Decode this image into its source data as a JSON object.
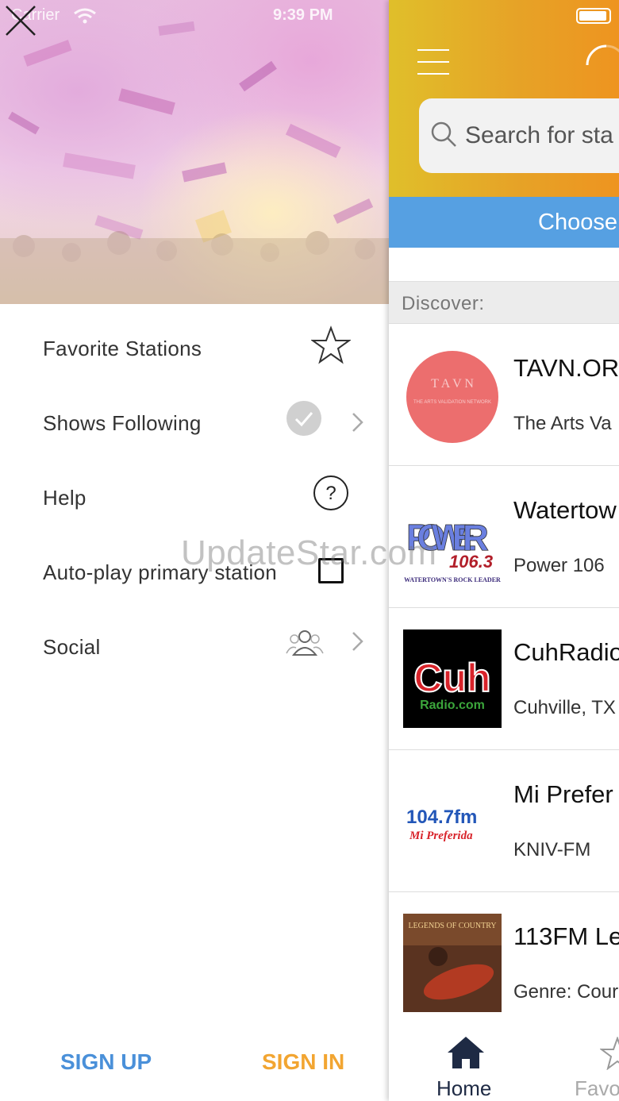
{
  "status_bar": {
    "carrier": "Carrier",
    "time": "9:39 PM"
  },
  "drawer": {
    "menu": [
      {
        "label": "Favorite Stations",
        "icon": "star-outline-icon"
      },
      {
        "label": "Shows Following",
        "icon": "check-circle-icon"
      },
      {
        "label": "Help",
        "icon": "question-circle-icon"
      },
      {
        "label": "Auto-play primary station",
        "icon": "checkbox-icon",
        "checked": false
      },
      {
        "label": "Social",
        "icon": "people-icon"
      }
    ],
    "sign_up_label": "SIGN UP",
    "sign_in_label": "SIGN IN"
  },
  "watermark": "UpdateStar.com",
  "main": {
    "search_placeholder": "Search for sta",
    "choose_label": "Choose",
    "discover_label": "Discover:",
    "stations": [
      {
        "name": "TAVN.OR",
        "subtitle": "The Arts Va",
        "logo_text": "T A V N",
        "logo_subtext": "THE ARTS VALIDATION NETWORK"
      },
      {
        "name": "Watertow",
        "subtitle": "Power 106",
        "logo_text": "POWER",
        "logo_number": "106.3",
        "logo_subtext": "WATERTOWN'S ROCK LEADER"
      },
      {
        "name": "CuhRadio",
        "subtitle": "Cuhville, TX",
        "logo_text": "Cuh",
        "logo_subtext": "Radio.com"
      },
      {
        "name": "Mi Prefer",
        "subtitle": "KNIV-FM",
        "logo_text": "104.7fm",
        "logo_subtext": "Mi Preferida"
      },
      {
        "name": "113FM Le",
        "subtitle": "Genre: Cour",
        "logo_text": "LEGENDS OF COUNTRY"
      }
    ],
    "tabs": [
      {
        "label": "Home",
        "icon": "home-icon",
        "active": true
      },
      {
        "label": "Favo",
        "icon": "star-icon",
        "active": false
      }
    ]
  },
  "colors": {
    "sign_up": "#4a90d9",
    "sign_in": "#f2a531",
    "choose_bar": "#56a0e2",
    "header_start": "#e0bf2a",
    "header_end": "#ee9420"
  }
}
